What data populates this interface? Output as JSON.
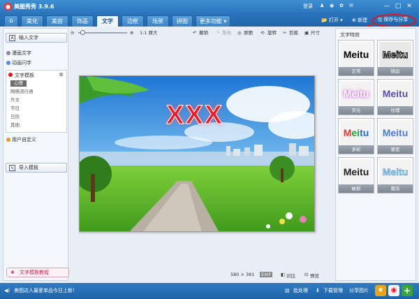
{
  "titlebar": {
    "title": "美图秀秀 3.9.6",
    "login": "登录",
    "minimize": "—",
    "maximize": "□",
    "close": "✕"
  },
  "tabs": [
    "美化",
    "美容",
    "饰品",
    "文字",
    "边框",
    "场景",
    "拼图",
    "更多功能 ▾"
  ],
  "active_tab": "文字",
  "topbuttons": {
    "open": "打开",
    "new": "新建",
    "save_share": "保存与分享"
  },
  "left": {
    "input_text": "输入文字",
    "comic_text": "漫画文字",
    "anim_text": "动画闪字",
    "template": "文字模板",
    "subitems": [
      "心情",
      "网络流行语",
      "外文",
      "节日",
      "日历",
      "其他"
    ],
    "custom": "用户自定义",
    "import": "导入模板",
    "guide": "文字模板教程"
  },
  "toolbar": {
    "original_size": "1:1 原大",
    "undo": "撤销",
    "redo": "重做",
    "original": "原图",
    "rotate": "旋转",
    "crop": "剪裁",
    "resize": "尺寸"
  },
  "photo_text": "XXX",
  "status": {
    "size": "580 × 381",
    "exif": "EXIF",
    "compare": "对比",
    "preview": "预览"
  },
  "right": {
    "title": "文字特效",
    "sample": "Meitu",
    "effects": [
      "正常",
      "描边",
      "荧光",
      "纹理",
      "多彩",
      "渐变",
      "破损",
      "霜冻"
    ]
  },
  "bottom": {
    "news": "美图达人最爱单品今日上新!",
    "batch": "批处理",
    "download": "下载管理",
    "share": "分享图片"
  },
  "colors": {
    "title_blue": "#2b74bd",
    "highlight": "#e2141b",
    "text_red": "#e61e26"
  }
}
